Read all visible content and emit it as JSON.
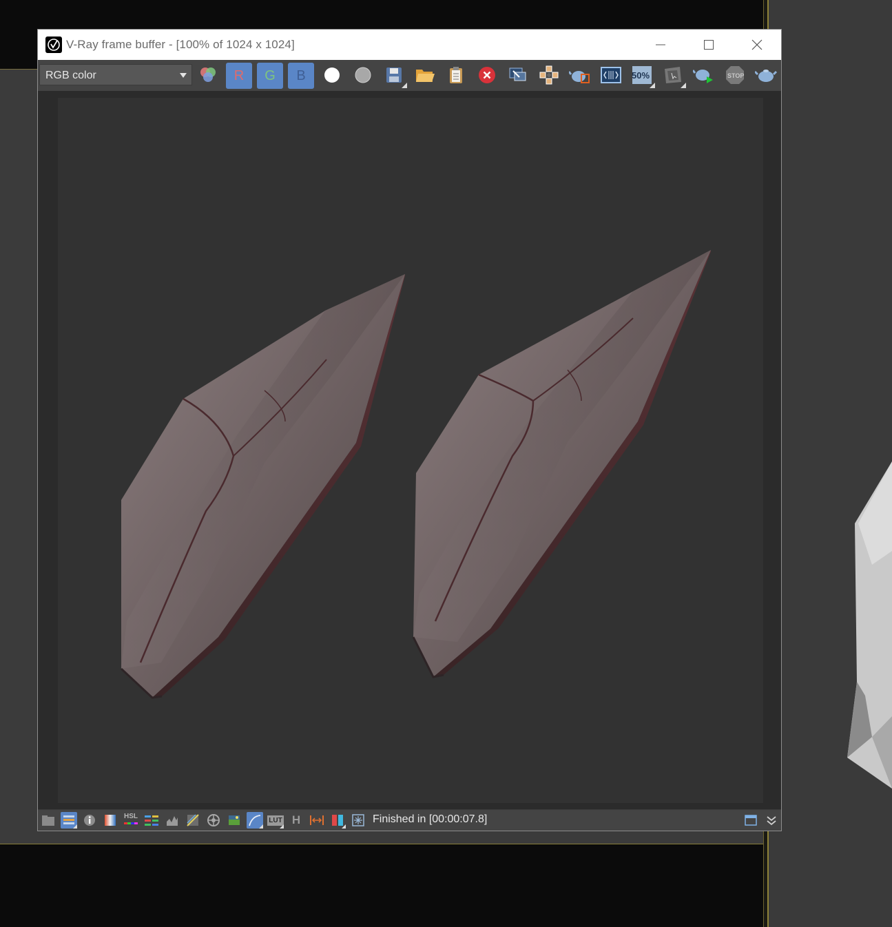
{
  "window": {
    "title": "V-Ray frame buffer - [100% of 1024 x 1024]",
    "minimize_label": "Minimize",
    "maximize_label": "Maximize",
    "close_label": "Close"
  },
  "toolbar": {
    "channel_select_value": "RGB color",
    "red_label": "R",
    "green_label": "G",
    "blue_label": "B",
    "zoom_label": "50%",
    "stop_label": "STOP",
    "buttons": [
      "color-channels-icon",
      "red-channel-button",
      "green-channel-button",
      "blue-channel-button",
      "white-swatch-icon",
      "gray-swatch-icon",
      "save-icon",
      "open-folder-icon",
      "clipboard-icon",
      "clear-icon",
      "region-render-icon",
      "track-mouse-icon",
      "render-teapot-icon",
      "compare-icon",
      "zoom-50-icon",
      "render-region-icon",
      "interactive-render-icon",
      "stop-icon",
      "render-last-icon"
    ]
  },
  "statusbar": {
    "status_text": "Finished in [00:00:07.8]",
    "hsl_label": "HSL",
    "lut_label": "LUT",
    "h_label": "H"
  },
  "colors": {
    "accent_blue": "#5a86c7",
    "toolbar_bg": "#444444",
    "render_bg": "#323232"
  }
}
